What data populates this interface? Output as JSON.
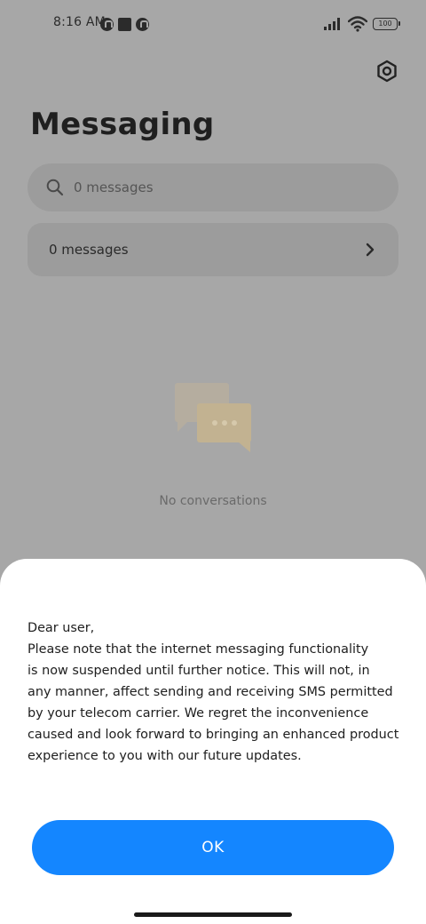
{
  "status_bar": {
    "time": "8:16 AM",
    "battery": "100"
  },
  "header": {
    "title": "Messaging",
    "settings_icon": "gear-icon"
  },
  "search": {
    "placeholder": "0 messages"
  },
  "messages_row": {
    "label": "0 messages"
  },
  "empty_state": {
    "text": "No conversations"
  },
  "dialog": {
    "lines": [
      "Dear user,",
      "Please note that the internet messaging functionality",
      "is now suspended until further notice. This will not, in",
      "any manner, affect sending and receiving SMS permitted",
      "by your telecom carrier. We regret the inconvenience",
      "caused and look forward to bringing an enhanced product",
      "experience to you with our future updates."
    ],
    "ok_label": "OK"
  },
  "colors": {
    "accent": "#1486ff",
    "scrim_background": "#a7a7a7",
    "card_background": "#9c9c9c",
    "illustration": "#c2b291"
  }
}
